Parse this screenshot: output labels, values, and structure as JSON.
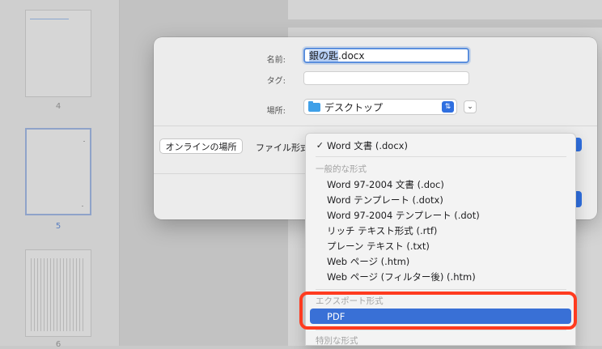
{
  "thumbnails": [
    {
      "page": "4"
    },
    {
      "page": "5"
    },
    {
      "page": "6"
    }
  ],
  "dialog": {
    "name_label": "名前:",
    "name_selected": "銀の匙",
    "name_rest": ".docx",
    "tags_label": "タグ:",
    "tags_value": "",
    "location_label": "場所:",
    "location_value": "デスクトップ",
    "online_button": "オンラインの場所",
    "format_label": "ファイル形式"
  },
  "menu": {
    "selected": "Word 文書 (.docx)",
    "check_mark": "✓",
    "common_header": "一般的な形式",
    "common_items": [
      "Word 97-2004 文書 (.doc)",
      "Word テンプレート (.dotx)",
      "Word 97-2004 テンプレート (.dot)",
      "リッチ テキスト形式 (.rtf)",
      "プレーン テキスト (.txt)",
      "Web ページ (.htm)",
      "Web ページ (フィルター後) (.htm)"
    ],
    "export_header": "エクスポート形式",
    "export_items": [
      "PDF"
    ],
    "special_header": "特別な形式"
  },
  "colors": {
    "accent": "#3970d6",
    "highlight": "#ff3b1f"
  }
}
